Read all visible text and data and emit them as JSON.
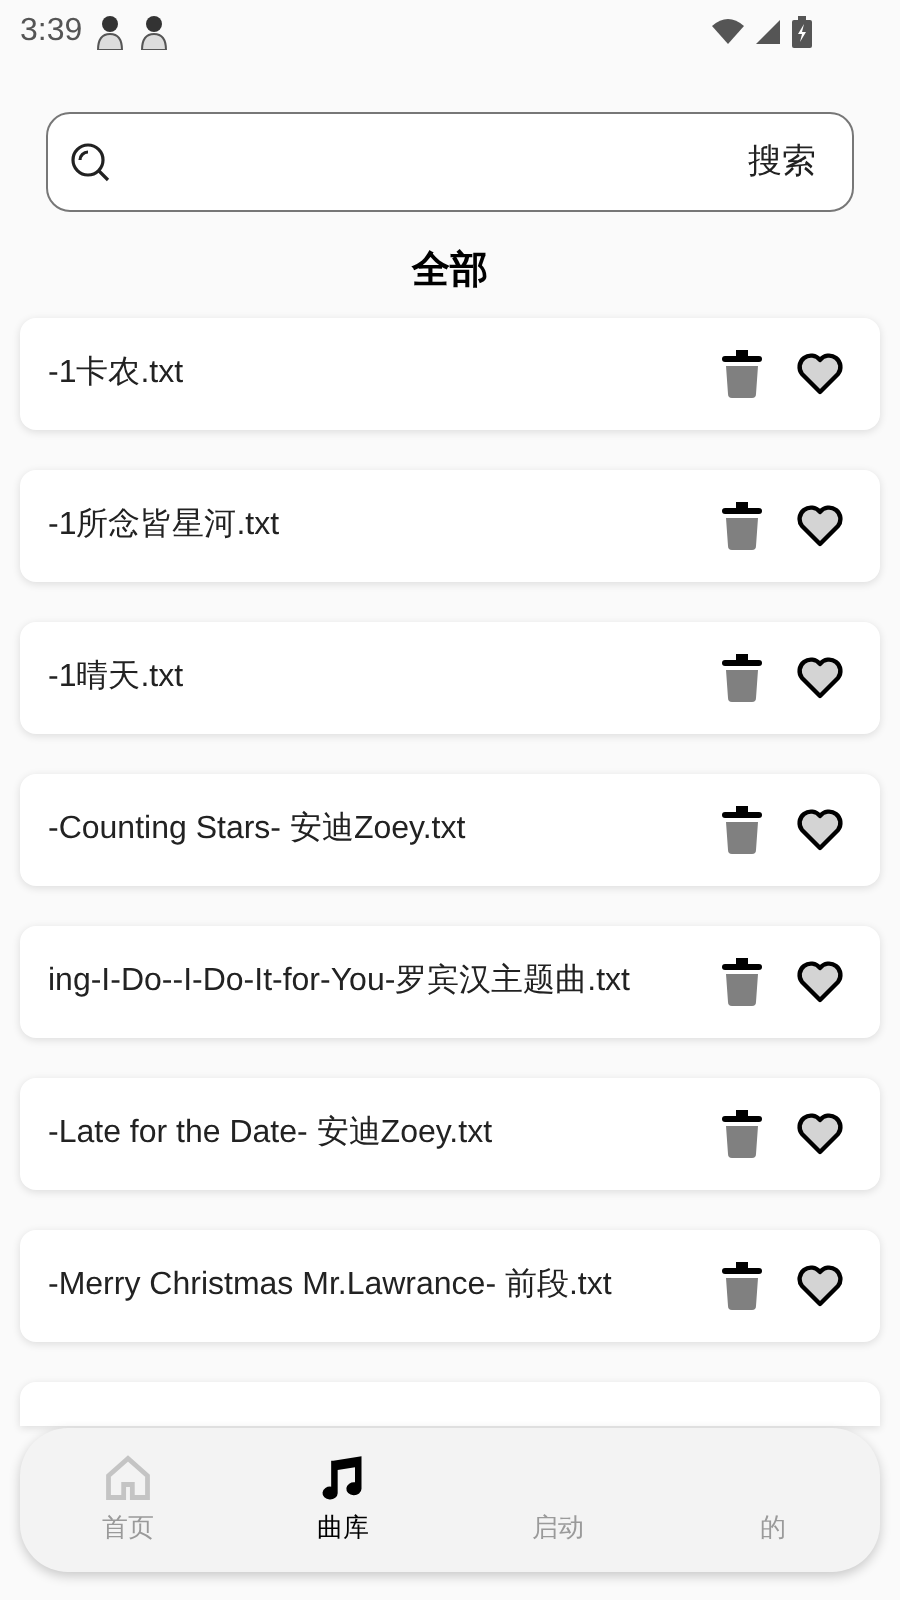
{
  "status_bar": {
    "time": "3:39"
  },
  "search": {
    "button": "搜索"
  },
  "section_title": "全部",
  "files": [
    {
      "name": "-1卡农.txt"
    },
    {
      "name": "-1所念皆星河.txt"
    },
    {
      "name": "-1晴天.txt"
    },
    {
      "name": "-Counting Stars- 安迪Zoey.txt"
    },
    {
      "name": "ing-I-Do--I-Do-It-for-You-罗宾汉主题曲.txt"
    },
    {
      "name": "-Late for the Date- 安迪Zoey.txt"
    },
    {
      "name": "-Merry Christmas Mr.Lawrance- 前段.txt"
    }
  ],
  "bottom_nav": [
    {
      "label": "首页",
      "kind": "home",
      "selected": false
    },
    {
      "label": "曲库",
      "kind": "music",
      "selected": true
    },
    {
      "label": "启动",
      "kind": "hidden",
      "selected": false
    },
    {
      "label": "的",
      "kind": "hidden",
      "selected": false
    }
  ]
}
